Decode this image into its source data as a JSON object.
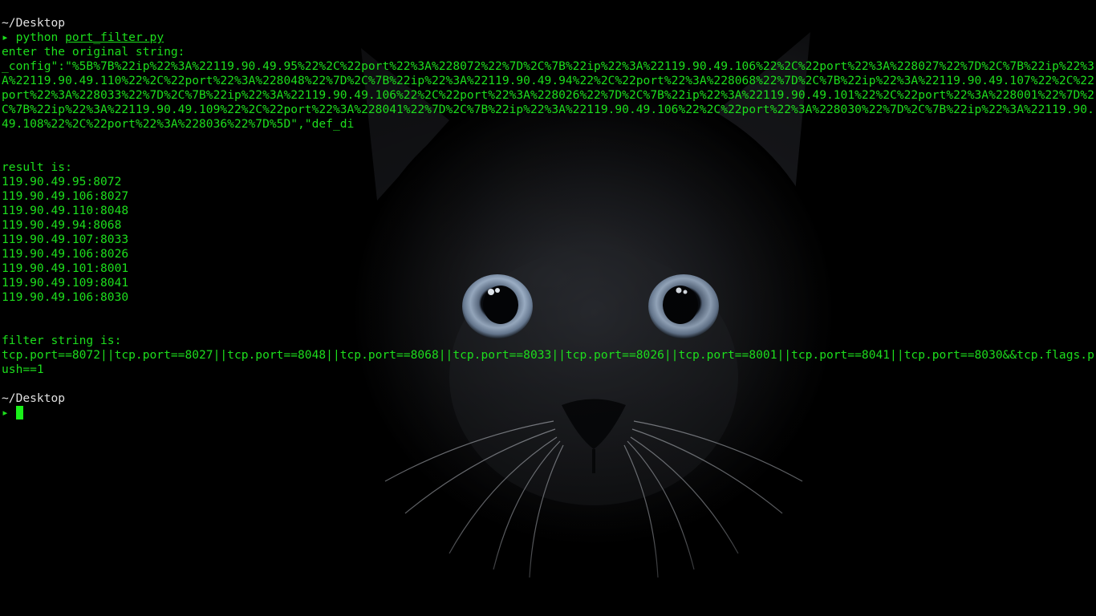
{
  "terminal": {
    "cwd_1": "~/Desktop",
    "prompt_symbol": "▸",
    "command": "python",
    "command_file": "port_filter.py",
    "input_prompt": "enter the original string:",
    "input_value": "_config\":\"%5B%7B%22ip%22%3A%22119.90.49.95%22%2C%22port%22%3A%228072%22%7D%2C%7B%22ip%22%3A%22119.90.49.106%22%2C%22port%22%3A%228027%22%7D%2C%7B%22ip%22%3A%22119.90.49.110%22%2C%22port%22%3A%228048%22%7D%2C%7B%22ip%22%3A%22119.90.49.94%22%2C%22port%22%3A%228068%22%7D%2C%7B%22ip%22%3A%22119.90.49.107%22%2C%22port%22%3A%228033%22%7D%2C%7B%22ip%22%3A%22119.90.49.106%22%2C%22port%22%3A%228026%22%7D%2C%7B%22ip%22%3A%22119.90.49.101%22%2C%22port%22%3A%228001%22%7D%2C%7B%22ip%22%3A%22119.90.49.109%22%2C%22port%22%3A%228041%22%7D%2C%7B%22ip%22%3A%22119.90.49.106%22%2C%22port%22%3A%228030%22%7D%2C%7B%22ip%22%3A%22119.90.49.108%22%2C%22port%22%3A%228036%22%7D%5D\",\"def_di",
    "result_heading": "result is:",
    "results": [
      "119.90.49.95:8072",
      "119.90.49.106:8027",
      "119.90.49.110:8048",
      "119.90.49.94:8068",
      "119.90.49.107:8033",
      "119.90.49.106:8026",
      "119.90.49.101:8001",
      "119.90.49.109:8041",
      "119.90.49.106:8030"
    ],
    "filter_heading": "filter string is:",
    "filter_value": "tcp.port==8072||tcp.port==8027||tcp.port==8048||tcp.port==8068||tcp.port==8033||tcp.port==8026||tcp.port==8001||tcp.port==8041||tcp.port==8030&&tcp.flags.push==1",
    "cwd_2": "~/Desktop",
    "colors": {
      "text": "#1dde1d",
      "cwd": "#e0e0e0",
      "background": "#000000",
      "cursor": "#19f019"
    }
  },
  "wallpaper": {
    "subject": "black-cat-face"
  }
}
